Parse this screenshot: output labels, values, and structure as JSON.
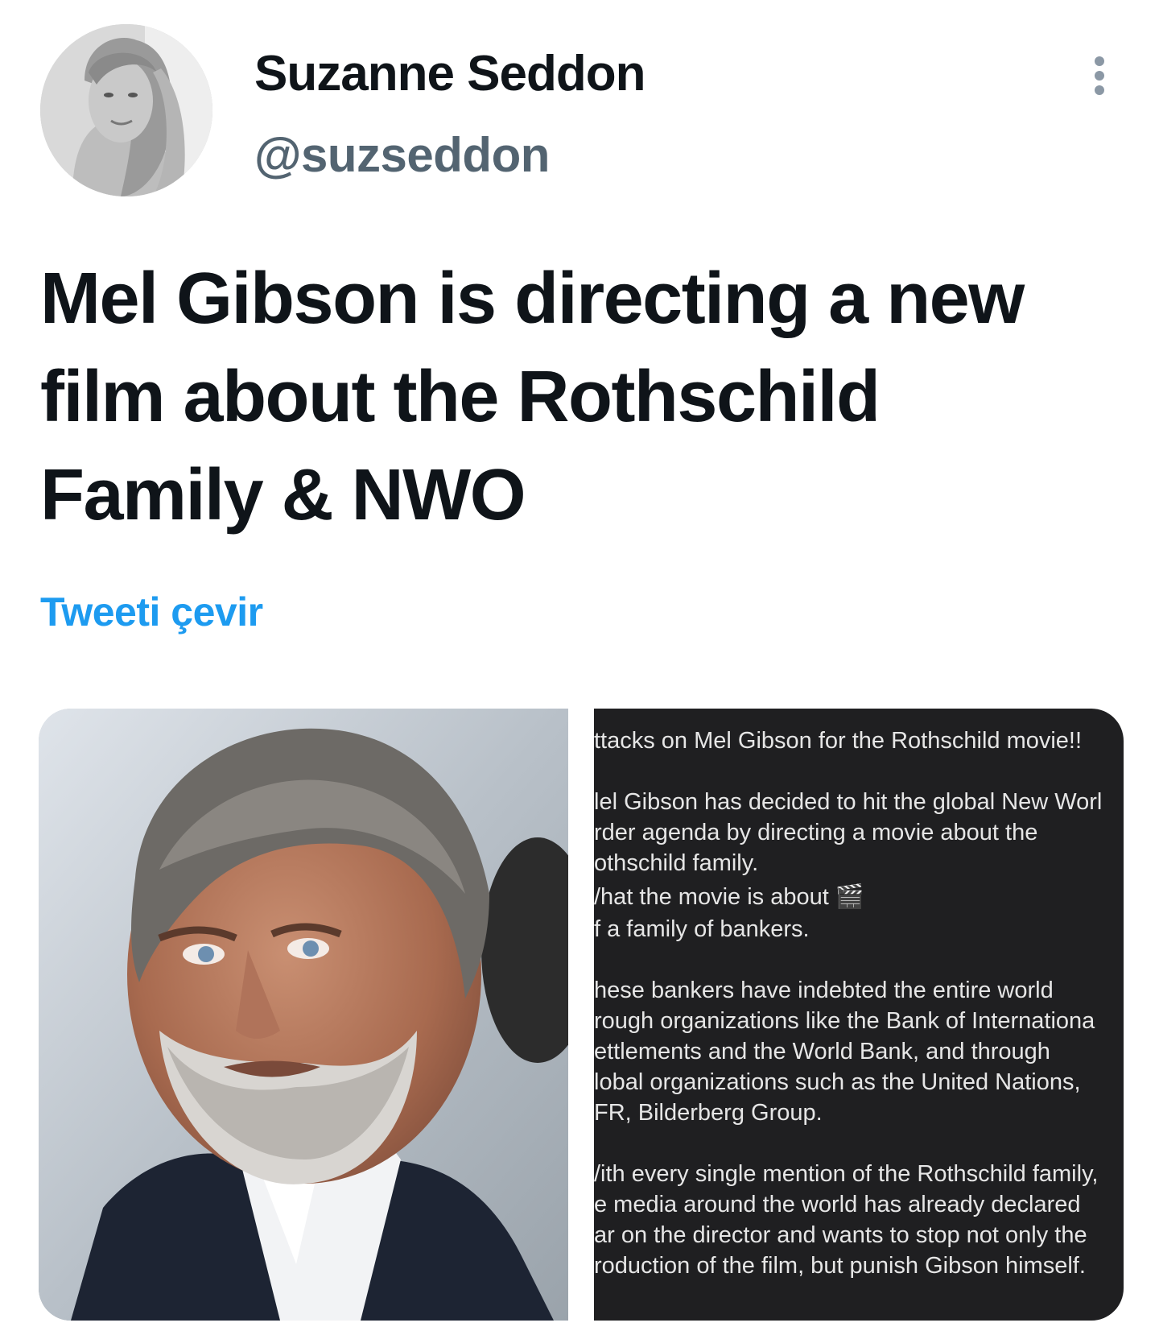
{
  "author": {
    "display_name": "Suzanne Seddon",
    "handle": "@suzseddon",
    "avatar_icon": "profile-photo"
  },
  "more_icon": "more-vertical-icon",
  "tweet": {
    "text": "Mel Gibson is directing a new film about the Rothschild Family & NWO",
    "translate_label": "Tweeti çevir"
  },
  "media": {
    "photo_icon": "man-portrait-photo",
    "screenshot_lines": [
      "ttacks on Mel Gibson for the Rothschild movie!!",
      "",
      "lel Gibson has decided to hit the global New Worl",
      "rder agenda by directing a movie about the",
      "othschild family.",
      "/hat the movie is about 🎬",
      "f a family of bankers.",
      "",
      "hese bankers have indebted the entire world",
      "rough organizations like the Bank of Internationa",
      "ettlements and the World Bank, and through",
      "lobal organizations such as the United Nations,",
      "FR, Bilderberg Group.",
      "",
      "/ith every single mention of the Rothschild family,",
      "e media around the world has already declared",
      "ar on the director and wants to stop not only the",
      "roduction of the film, but punish Gibson himself."
    ]
  },
  "colors": {
    "text_primary": "#0f1419",
    "text_secondary": "#536471",
    "link": "#1d9bf0",
    "screenshot_bg": "#1f1f21"
  }
}
